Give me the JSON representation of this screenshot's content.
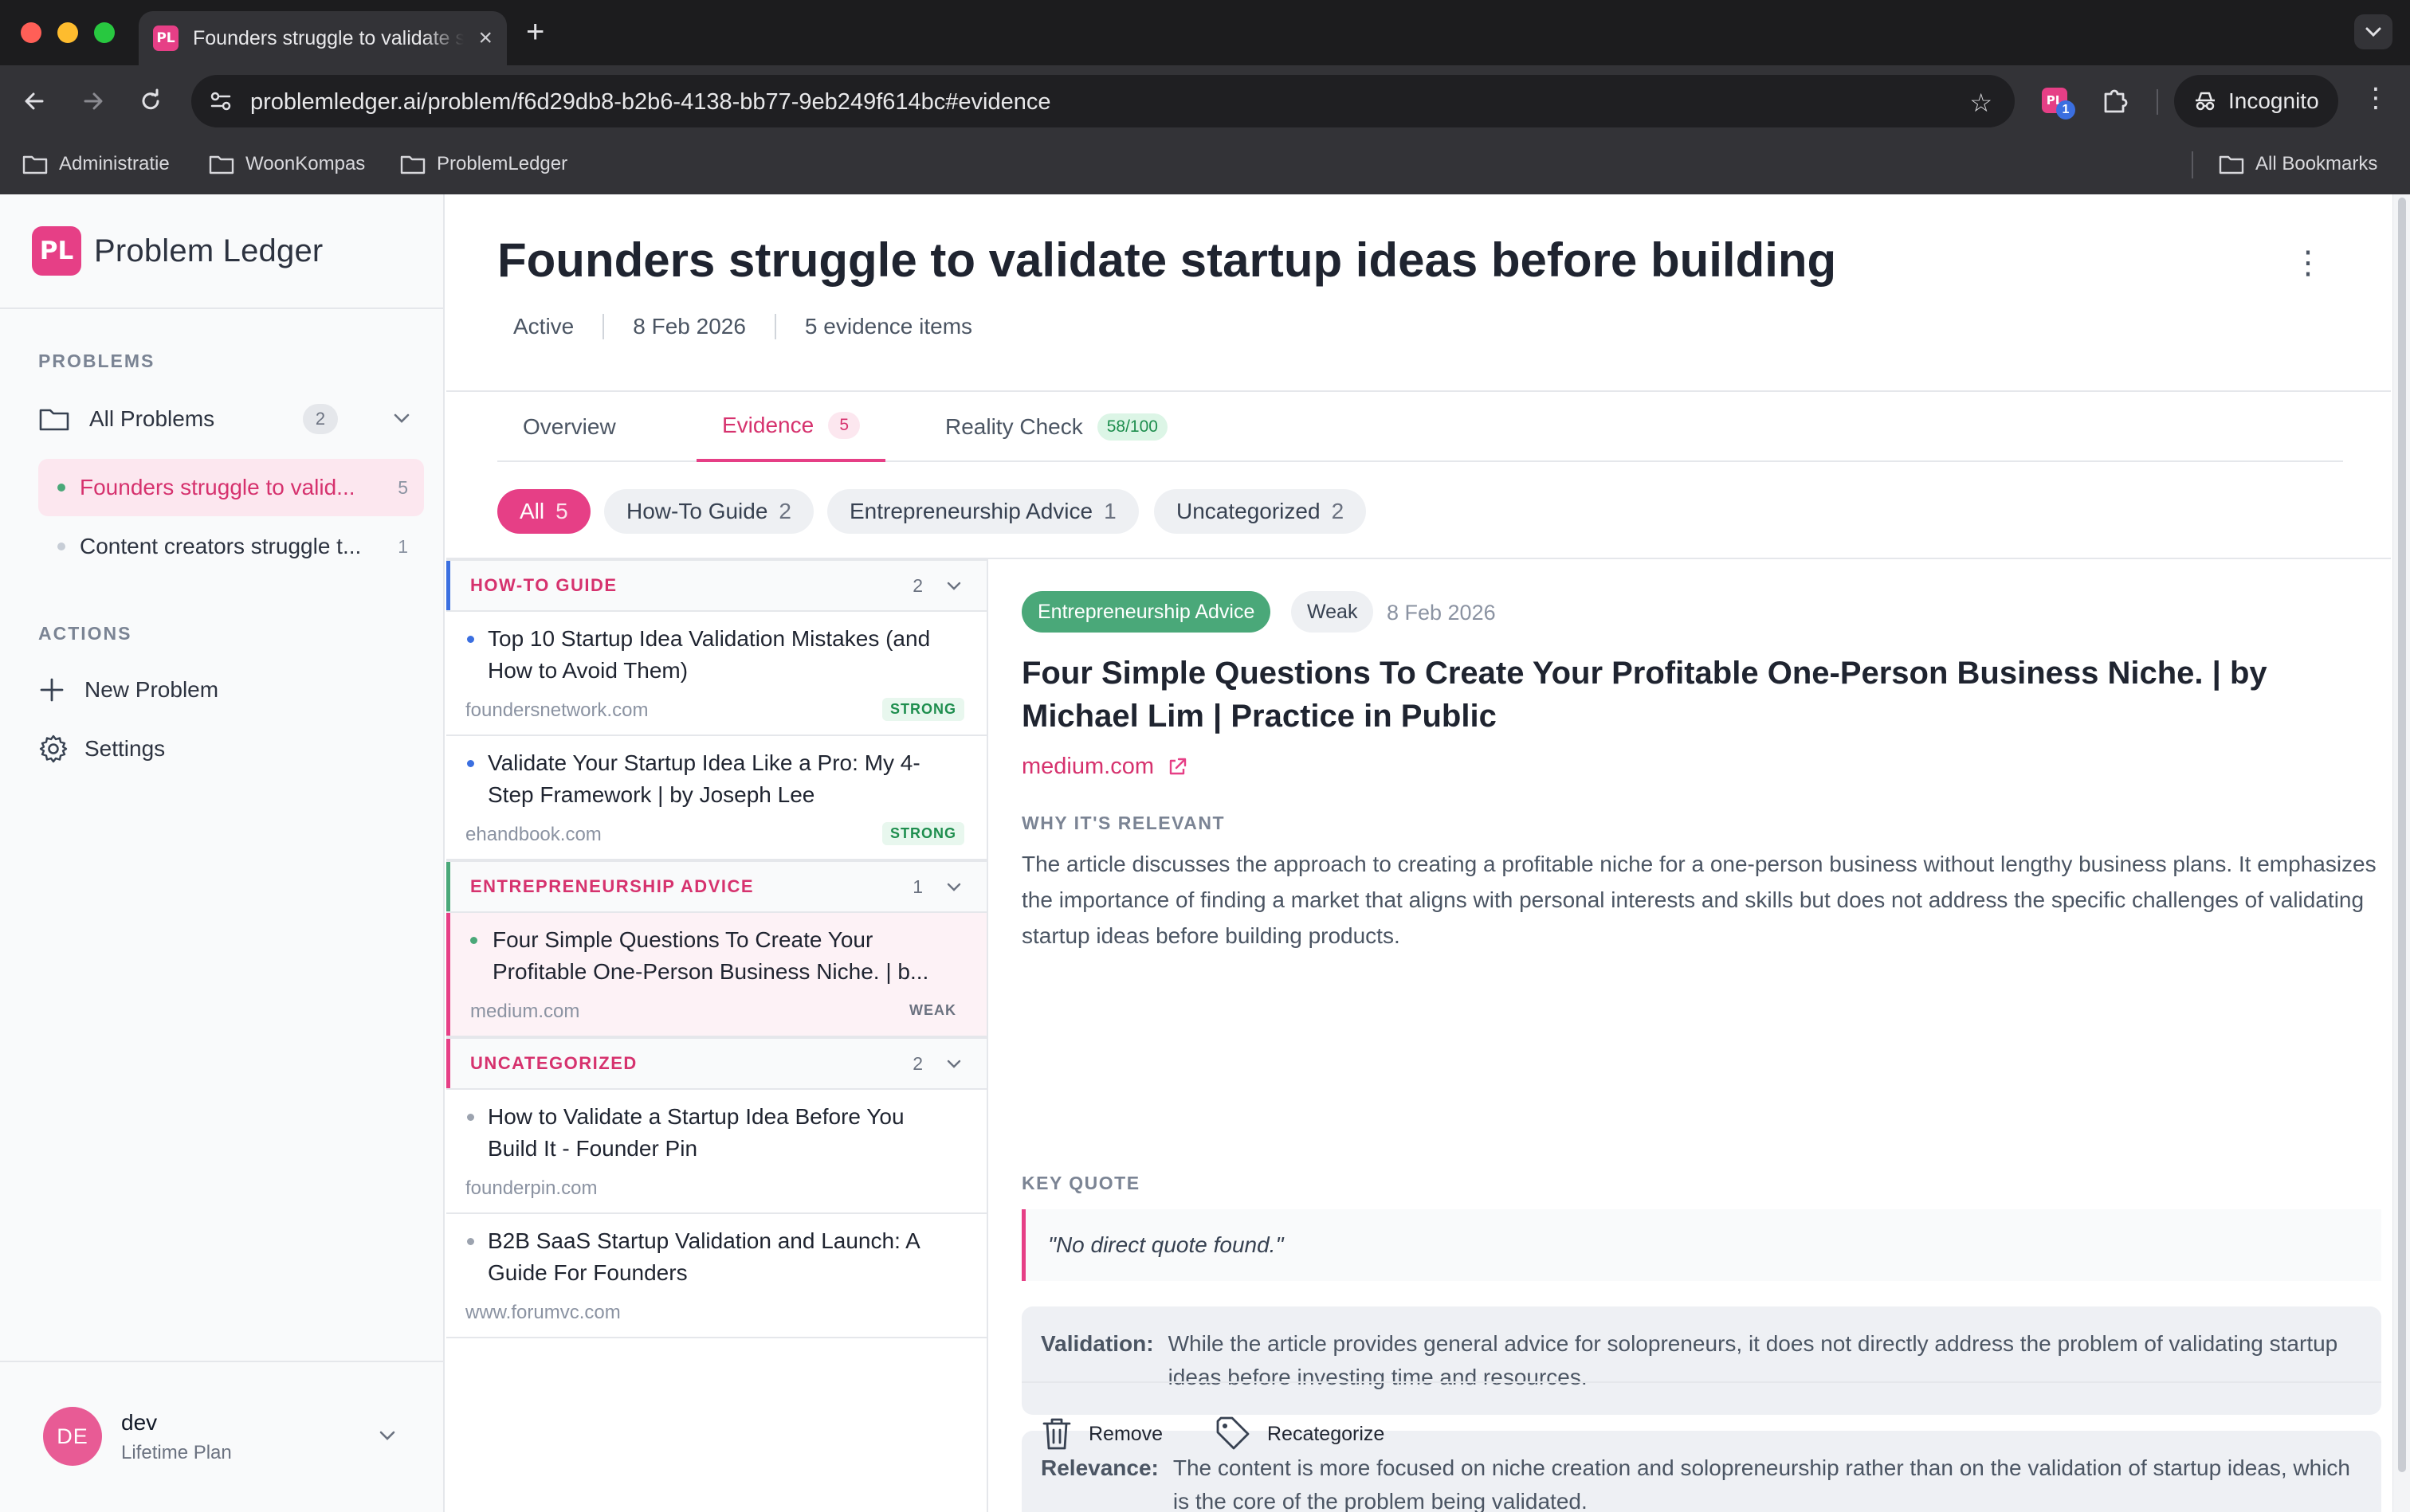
{
  "browser": {
    "tab_title": "Founders struggle to validate startup ideas before building",
    "favicon": "PL",
    "url": "problemledger.ai/problem/f6d29db8-b2b6-4138-bb77-9eb249f614bc#evidence",
    "extension_badge": "1",
    "incognito_label": "Incognito",
    "bookmarks": [
      "Administratie",
      "WoonKompas",
      "ProblemLedger"
    ],
    "all_bookmarks": "All Bookmarks"
  },
  "sidebar": {
    "logo_mark": "PL",
    "app_name": "Problem Ledger",
    "problems_section": "PROBLEMS",
    "all_problems_label": "All Problems",
    "all_problems_count": "2",
    "problems": [
      {
        "title": "Founders struggle to valid...",
        "count": "5",
        "active": true
      },
      {
        "title": "Content creators struggle t...",
        "count": "1",
        "active": false
      }
    ],
    "actions_section": "ACTIONS",
    "new_problem_label": "New Problem",
    "settings_label": "Settings",
    "user": {
      "initials": "DE",
      "name": "dev",
      "plan": "Lifetime Plan"
    }
  },
  "header": {
    "title": "Founders struggle to validate startup ideas before building",
    "status": "Active",
    "date": "8 Feb 2026",
    "evidence_count": "5 evidence items"
  },
  "tabs": [
    {
      "label": "Overview",
      "badge": ""
    },
    {
      "label": "Evidence",
      "badge": "5"
    },
    {
      "label": "Reality Check",
      "badge": "58/100"
    }
  ],
  "filters": [
    {
      "label": "All",
      "count": "5"
    },
    {
      "label": "How-To Guide",
      "count": "2"
    },
    {
      "label": "Entrepreneurship Advice",
      "count": "1"
    },
    {
      "label": "Uncategorized",
      "count": "2"
    }
  ],
  "groups": [
    {
      "name": "HOW-TO GUIDE",
      "count": "2",
      "color": "#3b6fe0"
    },
    {
      "name": "ENTREPRENEURSHIP ADVICE",
      "count": "1",
      "color": "#4aa879"
    },
    {
      "name": "UNCATEGORIZED",
      "count": "2",
      "color": "#e63f86"
    }
  ],
  "evidence": [
    {
      "title_line1": "Top 10 Startup Idea Validation Mistakes (and",
      "title_line2": "How to Avoid Them)",
      "domain": "foundersnetwork.com",
      "strength": "STRONG"
    },
    {
      "title_line1": "Validate Your Startup Idea Like a Pro: My 4-",
      "title_line2": "Step Framework | by Joseph Lee",
      "domain": "ehandbook.com",
      "strength": "STRONG"
    },
    {
      "title_line1": "Four Simple Questions To Create Your",
      "title_line2": "Profitable One-Person Business Niche. | b...",
      "domain": "medium.com",
      "strength": "WEAK"
    },
    {
      "title_line1": "How to Validate a Startup Idea Before You",
      "title_line2": "Build It - Founder Pin",
      "domain": "founderpin.com",
      "strength": ""
    },
    {
      "title_line1": "B2B SaaS Startup Validation and Launch: A",
      "title_line2": "Guide For Founders",
      "domain": "www.forumvc.com",
      "strength": ""
    }
  ],
  "detail": {
    "category": "Entrepreneurship Advice",
    "strength": "Weak",
    "date": "8 Feb 2026",
    "title": "Four Simple Questions To Create Your Profitable One-Person Business Niche. | by Michael Lim | Practice in Public",
    "source": "medium.com",
    "why_label": "WHY IT'S RELEVANT",
    "why_text": "The article discusses the approach to creating a profitable niche for a one-person business without lengthy business plans. It emphasizes the importance of finding a market that aligns with personal interests and skills but does not address the specific challenges of validating startup ideas before building products.",
    "quote_label": "KEY QUOTE",
    "quote": "\"No direct quote found.\"",
    "validation_label": "Validation:",
    "validation_text": "While the article provides general advice for solopreneurs, it does not directly address the problem of validating startup ideas before investing time and resources.",
    "relevance_label": "Relevance:",
    "relevance_text": "The content is more focused on niche creation and solopreneurship rather than on the validation of startup ideas, which is the core of the problem being validated.",
    "remove_label": "Remove",
    "recategorize_label": "Recategorize"
  },
  "colors": {
    "accent": "#e63f86",
    "green": "#4aa879",
    "blue": "#3b6fe0"
  }
}
